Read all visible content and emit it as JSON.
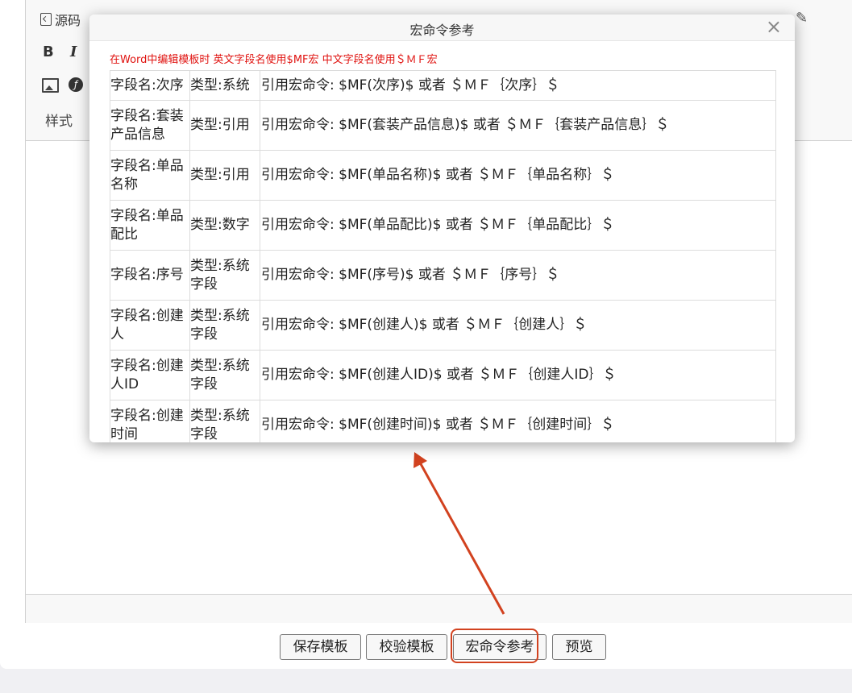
{
  "toolbar": {
    "source_label": "源码",
    "bold_label": "B",
    "italic_label": "I",
    "style_label": "样式"
  },
  "modal": {
    "title": "宏命令参考",
    "close_glyph": "×",
    "hint": "在Word中编辑模板时 英文字段名使用$MF宏 中文字段名使用＄ＭＦ宏",
    "rows": [
      {
        "field": "字段名:次序",
        "type": "类型:系统",
        "macro": "引用宏命令:  $MF(次序)$  或者  ＄ＭＦ｛次序｝＄"
      },
      {
        "field": "字段名:套装产品信息",
        "type": "类型:引用",
        "macro": "引用宏命令:  $MF(套装产品信息)$  或者  ＄ＭＦ｛套装产品信息｝＄"
      },
      {
        "field": "字段名:单品名称",
        "type": "类型:引用",
        "macro": "引用宏命令:  $MF(单品名称)$  或者  ＄ＭＦ｛单品名称｝＄"
      },
      {
        "field": "字段名:单品配比",
        "type": "类型:数字",
        "macro": "引用宏命令:  $MF(单品配比)$  或者  ＄ＭＦ｛单品配比｝＄"
      },
      {
        "field": "字段名:序号",
        "type": "类型:系统字段",
        "macro": "引用宏命令:  $MF(序号)$  或者  ＄ＭＦ｛序号｝＄"
      },
      {
        "field": "字段名:创建人",
        "type": "类型:系统字段",
        "macro": "引用宏命令:  $MF(创建人)$  或者  ＄ＭＦ｛创建人｝＄"
      },
      {
        "field": "字段名:创建人ID",
        "type": "类型:系统字段",
        "macro": "引用宏命令:  $MF(创建人ID)$  或者  ＄ＭＦ｛创建人ID｝＄"
      },
      {
        "field": "字段名:创建时间",
        "type": "类型:系统字段",
        "macro": "引用宏命令:  $MF(创建时间)$  或者  ＄ＭＦ｛创建时间｝＄"
      }
    ]
  },
  "buttons": {
    "save": "保存模板",
    "verify": "校验模板",
    "macro": "宏命令参考",
    "preview": "预览"
  },
  "colors": {
    "hint_red": "#e0120f",
    "highlight": "#d2421f"
  }
}
